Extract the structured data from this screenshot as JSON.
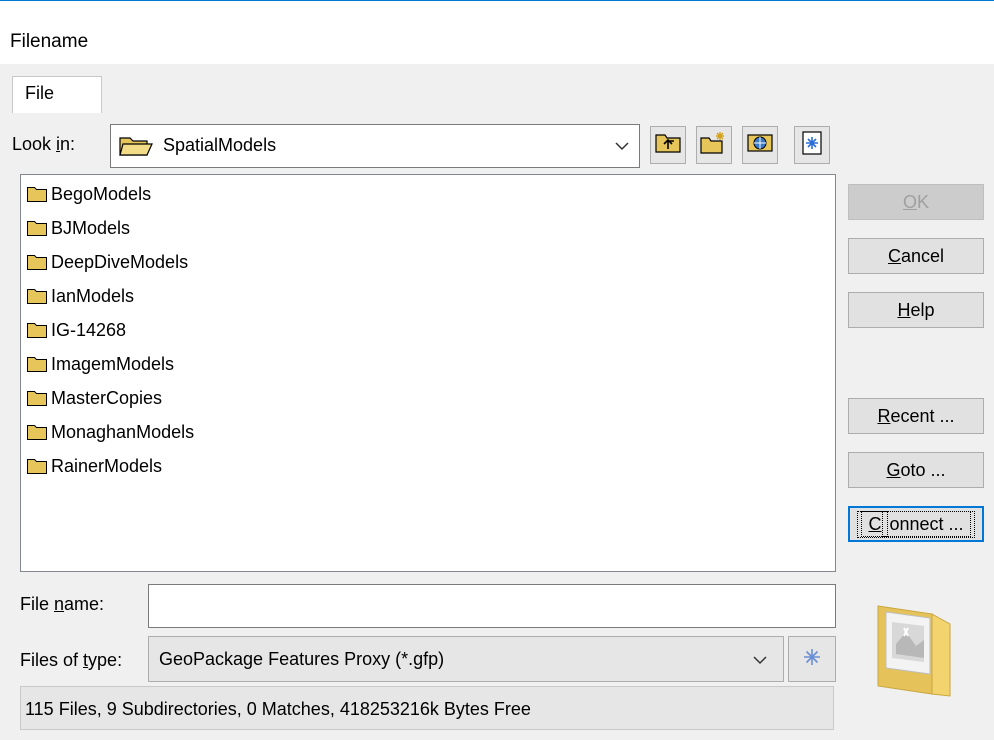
{
  "window": {
    "title": "Filename"
  },
  "tabs": [
    {
      "label": "File"
    }
  ],
  "look_in": {
    "label_pre": "Look ",
    "label_mnemonic": "i",
    "label_post": "n:",
    "value": "SpatialModels"
  },
  "toolbar": {
    "icons": [
      "up-one-level-icon",
      "create-new-folder-icon",
      "network-icon",
      "new-icon"
    ]
  },
  "files": [
    {
      "name": "BegoModels"
    },
    {
      "name": "BJModels"
    },
    {
      "name": "DeepDiveModels"
    },
    {
      "name": "IanModels"
    },
    {
      "name": "IG-14268"
    },
    {
      "name": "ImagemModels"
    },
    {
      "name": "MasterCopies"
    },
    {
      "name": "MonaghanModels"
    },
    {
      "name": "RainerModels"
    }
  ],
  "buttons": {
    "ok": {
      "mn": "O",
      "rest": "K"
    },
    "cancel": {
      "mn": "C",
      "rest": "ancel"
    },
    "help": {
      "mn": "H",
      "rest": "elp"
    },
    "recent": {
      "mn": "R",
      "rest": "ecent ..."
    },
    "goto": {
      "mn": "G",
      "rest": "oto ..."
    },
    "connect": {
      "mn": "C",
      "rest": "onnect ..."
    }
  },
  "file_name": {
    "label_pre": "File ",
    "label_mnemonic": "n",
    "label_post": "ame:",
    "value": ""
  },
  "file_type": {
    "label_pre": "Files of ",
    "label_mnemonic": "t",
    "label_post": "ype:",
    "value": "GeoPackage Features Proxy (*.gfp)"
  },
  "status": "115 Files, 9 Subdirectories, 0 Matches, 418253216k Bytes Free",
  "colors": {
    "accent": "#0078d7",
    "folder": "#e6c65a",
    "dialog_bg": "#f0f0f0"
  }
}
